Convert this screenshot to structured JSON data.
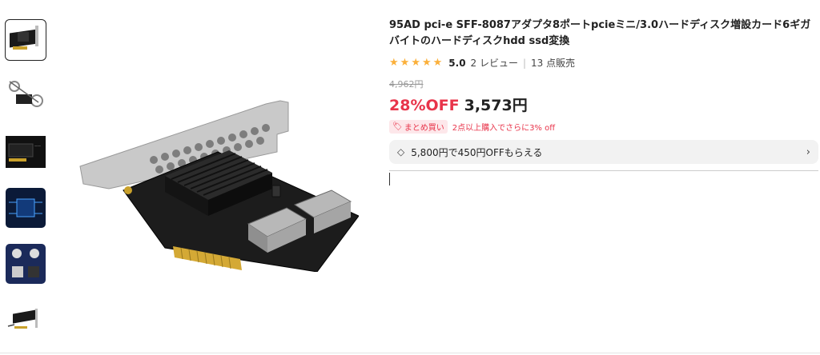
{
  "product": {
    "title": "95AD pci-e SFF-8087アダプタ8ポートpcieミニ/3.0ハードディスク増設カード6ギガバイトのハードディスクhdd ssd変換",
    "rating_score": "5.0",
    "review_count": "2 レビュー",
    "sold_count": "13 点販売",
    "original_price": "4,962円",
    "discount": "28%OFF",
    "price": "3,573円",
    "bulk_badge": "まとめ買い",
    "bulk_text": "2点以上購入でさらに3% off",
    "coupon_text": "5,800円で450円OFFもらえる"
  },
  "thumbnails": [
    {
      "name": "thumb-1",
      "active": true
    },
    {
      "name": "thumb-2",
      "active": false
    },
    {
      "name": "thumb-3",
      "active": false
    },
    {
      "name": "thumb-4",
      "active": false
    },
    {
      "name": "thumb-5",
      "active": false
    },
    {
      "name": "thumb-6",
      "active": false
    }
  ],
  "colors": {
    "accent_red": "#e8344a",
    "star": "#fbb03b"
  }
}
